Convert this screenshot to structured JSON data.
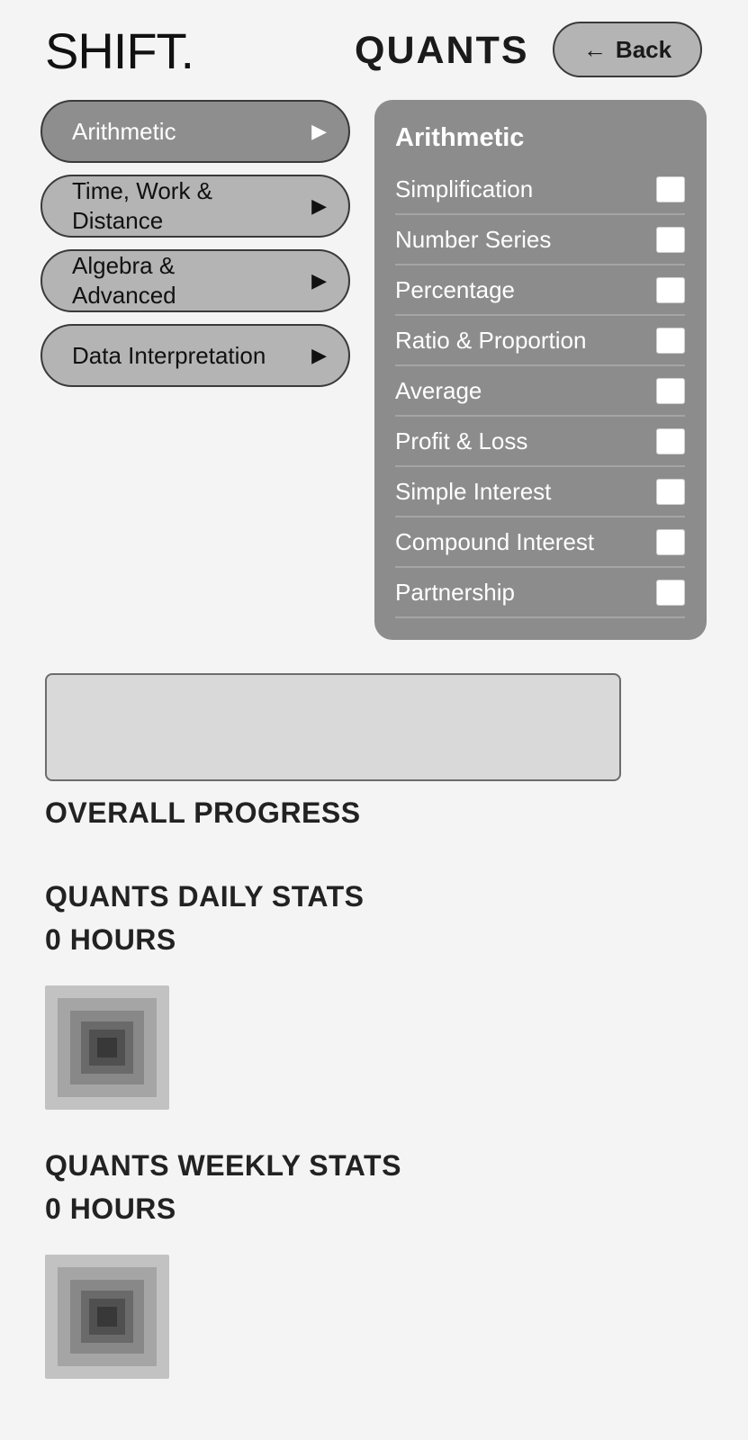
{
  "header": {
    "logo": "SHIFT.",
    "title": "QUANTS",
    "back_label": "Back",
    "back_icon": "←"
  },
  "categories": [
    {
      "label": "Arithmetic",
      "active": true
    },
    {
      "label": "Time, Work & Distance",
      "active": false
    },
    {
      "label": "Algebra & Advanced",
      "active": false
    },
    {
      "label": "Data Interpretation",
      "active": false
    }
  ],
  "category_arrow": "▶",
  "topic_panel": {
    "title": "Arithmetic",
    "topics": [
      {
        "label": "Simplification",
        "checked": false
      },
      {
        "label": "Number Series",
        "checked": false
      },
      {
        "label": "Percentage",
        "checked": false
      },
      {
        "label": "Ratio & Proportion",
        "checked": false
      },
      {
        "label": "Average",
        "checked": false
      },
      {
        "label": "Profit & Loss",
        "checked": false
      },
      {
        "label": "Simple Interest",
        "checked": false
      },
      {
        "label": "Compound Interest",
        "checked": false
      },
      {
        "label": "Partnership",
        "checked": false
      }
    ]
  },
  "progress": {
    "label": "OVERALL PROGRESS"
  },
  "daily_stats": {
    "title": "QUANTS DAILY STATS",
    "value": "0 HOURS"
  },
  "weekly_stats": {
    "title": "QUANTS WEEKLY STATS",
    "value": "0 HOURS"
  },
  "colors": {
    "background": "#f4f4f4",
    "button_bg": "#b4b4b4",
    "active_bg": "#8e8e8e",
    "panel_bg": "#8c8c8c"
  }
}
